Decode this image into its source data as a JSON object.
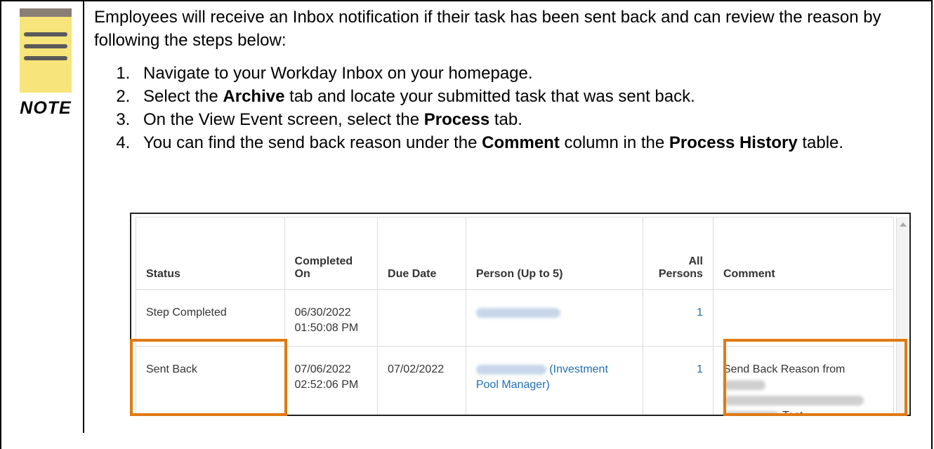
{
  "note": {
    "label": "NOTE",
    "colors": {
      "pad": "#f7e47a",
      "header": "#8a7f74",
      "lines": "#5a5a5a"
    }
  },
  "content": {
    "intro": "Employees will receive an Inbox notification if their task has been sent back and can review the reason by following the steps below:",
    "steps": {
      "s1": {
        "text": "Navigate to your Workday Inbox on your homepage."
      },
      "s2": {
        "pre": "Select the ",
        "b1": "Archive",
        "post": " tab and locate your submitted task that was sent back."
      },
      "s3": {
        "pre": "On the View Event screen, select the ",
        "b1": "Process",
        "post": " tab."
      },
      "s4": {
        "pre": "You can find the send back reason under the ",
        "b1": "Comment",
        "mid": " column in the ",
        "b2": "Process History",
        "post": " table."
      }
    }
  },
  "table": {
    "headers": {
      "status": "Status",
      "completed_on": "Completed On",
      "due_date": "Due Date",
      "person": "Person (Up to 5)",
      "all_persons_1": "All",
      "all_persons_2": "Persons",
      "comment": "Comment"
    },
    "rows": [
      {
        "status": "Step Completed",
        "completed_date": "06/30/2022",
        "completed_time": "01:50:08 PM",
        "due_date": "",
        "person_suffix": "",
        "all_persons": "1",
        "comment_pre": "",
        "comment_post": ""
      },
      {
        "status": "Sent Back",
        "completed_date": "07/06/2022",
        "completed_time": "02:52:06 PM",
        "due_date": "07/02/2022",
        "person_suffix": "(Investment",
        "person_suffix2": "Pool Manager)",
        "all_persons": "1",
        "comment_pre": "Send Back Reason from",
        "comment_post": "Test"
      }
    ],
    "highlight_color": "#e07a12",
    "link_color": "#1f6fb2"
  }
}
